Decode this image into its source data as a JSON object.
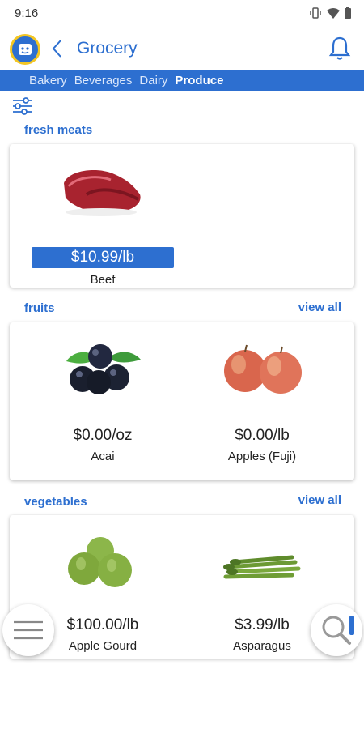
{
  "status_bar": {
    "time": "9:16"
  },
  "app_bar": {
    "title": "Grocery"
  },
  "tabs": [
    {
      "label": "Bakery",
      "active": false
    },
    {
      "label": "Beverages",
      "active": false
    },
    {
      "label": "Dairy",
      "active": false
    },
    {
      "label": "Produce",
      "active": true
    }
  ],
  "sections": [
    {
      "title": "fresh meats",
      "view_all": "",
      "items": [
        {
          "price": "$10.99/lb",
          "name": "Beef",
          "image": "beef-image"
        }
      ]
    },
    {
      "title": "fruits",
      "view_all": "view all",
      "items": [
        {
          "price": "$0.00/oz",
          "name": "Acai",
          "image": "acai-image"
        },
        {
          "price": "$0.00/lb",
          "name": "Apples (Fuji)",
          "image": "apples-image"
        }
      ]
    },
    {
      "title": "vegetables",
      "view_all": "view all",
      "items": [
        {
          "price": "$100.00/lb",
          "name": "Apple Gourd",
          "image": "apple-gourd-image"
        },
        {
          "price": "$3.99/lb",
          "name": "Asparagus",
          "image": "asparagus-image"
        }
      ]
    }
  ],
  "colors": {
    "primary": "#2d6fd0",
    "logo_ring": "#f3c623"
  }
}
